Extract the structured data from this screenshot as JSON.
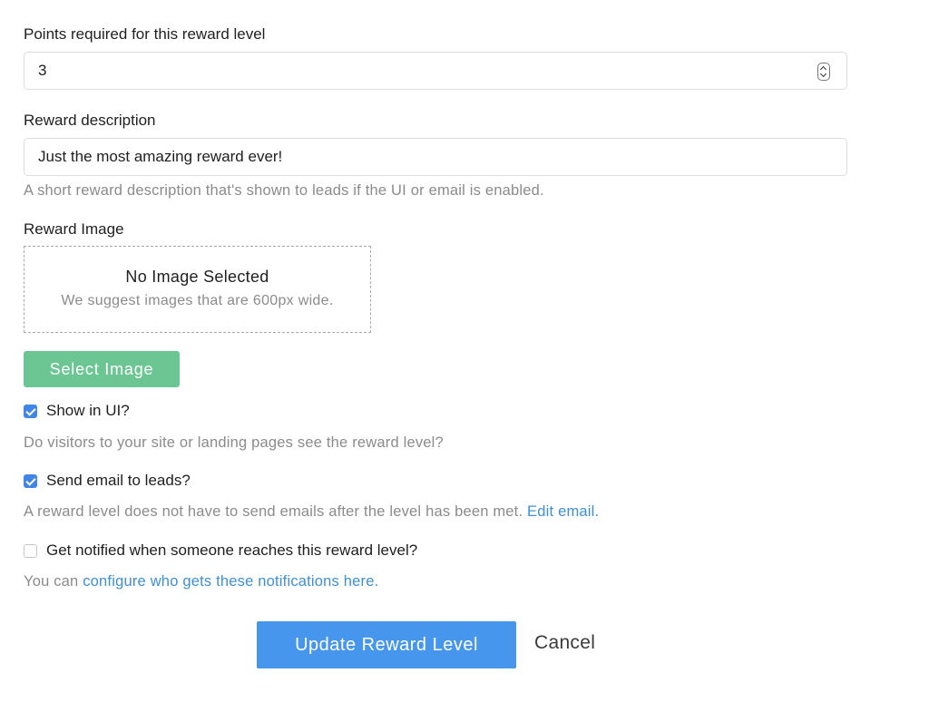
{
  "points": {
    "label": "Points required for this reward level",
    "value": "3"
  },
  "description": {
    "label": "Reward description",
    "value": "Just the most amazing reward ever!",
    "help": "A short reward description that's shown to leads if the UI or email is enabled."
  },
  "image": {
    "label": "Reward Image",
    "empty_title": "No Image Selected",
    "hint": "We suggest images that are 600px wide.",
    "select_label": "Select Image"
  },
  "show_in_ui": {
    "label": "Show in UI?",
    "checked": true,
    "help": "Do visitors to your site or landing pages see the reward level?"
  },
  "send_email": {
    "label": "Send email to leads?",
    "checked": true,
    "help": "A reward level does not have to send emails after the level has been met.",
    "link": "Edit email."
  },
  "notify": {
    "label": "Get notified when someone reaches this reward level?",
    "checked": false,
    "help_prefix": "You can",
    "link": "configure who gets these notifications here."
  },
  "actions": {
    "update_label": "Update Reward Level",
    "cancel_label": "Cancel"
  },
  "colors": {
    "primary": "#4596ec",
    "success": "#6cc693",
    "link": "#3d8fd8",
    "muted": "#8b8b8b"
  }
}
